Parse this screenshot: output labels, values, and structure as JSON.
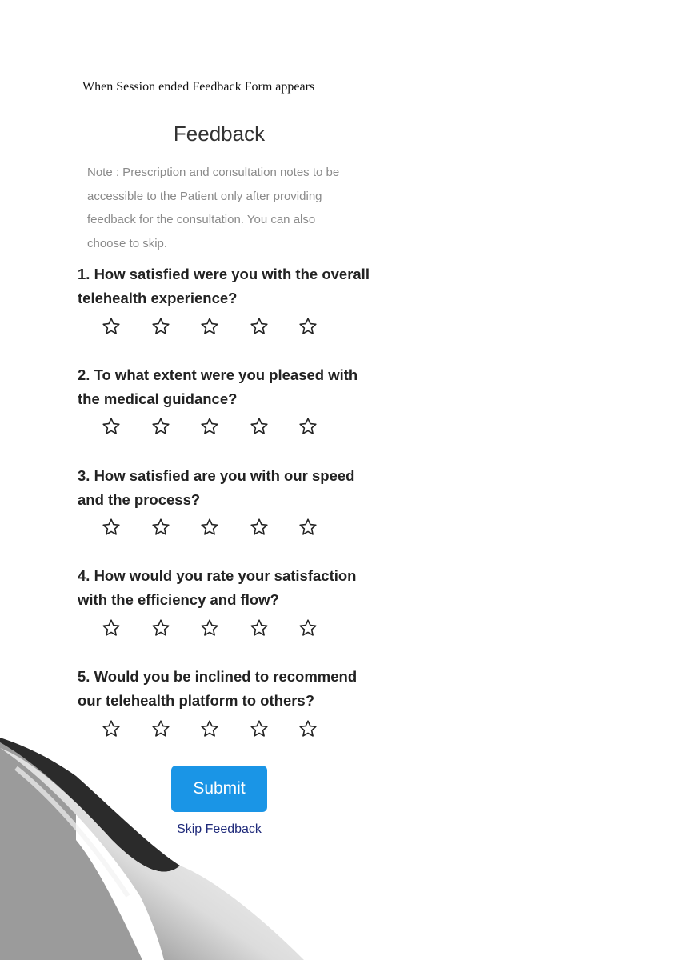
{
  "caption": "When Session ended Feedback Form appears",
  "form": {
    "title": "Feedback",
    "note": "Note : Prescription and consultation notes to be accessible to the Patient only after providing feedback for the consultation. You can also choose to skip.",
    "questions": [
      {
        "text": "1. How satisfied were you with the overall telehealth experience?",
        "rating": 0,
        "max": 5
      },
      {
        "text": "2. To what extent were you pleased with the medical guidance?",
        "rating": 0,
        "max": 5
      },
      {
        "text": "3. How satisfied are you with our speed and the process?",
        "rating": 0,
        "max": 5
      },
      {
        "text": "4. How would you rate your satisfaction with the efficiency and flow?",
        "rating": 0,
        "max": 5
      },
      {
        "text": "5. Would you be inclined to recommend our telehealth platform to others?",
        "rating": 0,
        "max": 5
      }
    ],
    "submit_label": "Submit",
    "skip_label": "Skip Feedback"
  },
  "colors": {
    "submit_bg": "#1a95e6",
    "skip_link": "#1f2a7a",
    "note_text": "#8a8a8a"
  },
  "icons": {
    "rating": "star-outline-icon",
    "decoration": "page-curl"
  }
}
